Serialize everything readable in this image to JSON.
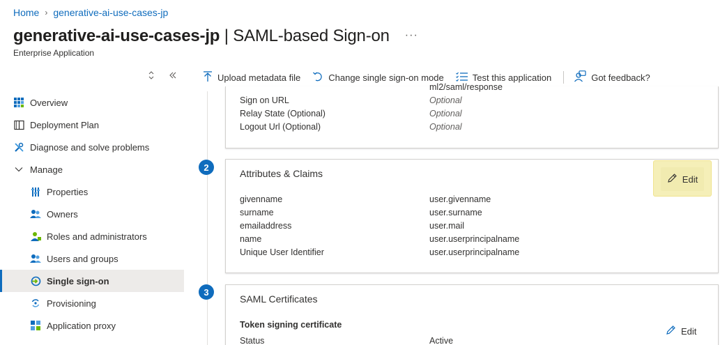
{
  "breadcrumb": {
    "home": "Home",
    "app": "generative-ai-use-cases-jp"
  },
  "header": {
    "title_app": "generative-ai-use-cases-jp",
    "title_sep": " | ",
    "title_page": "SAML-based Sign-on",
    "more": "···",
    "subtitle": "Enterprise Application"
  },
  "sidebar": {
    "items": [
      {
        "label": "Overview"
      },
      {
        "label": "Deployment Plan"
      },
      {
        "label": "Diagnose and solve problems"
      },
      {
        "label": "Manage"
      },
      {
        "label": "Properties"
      },
      {
        "label": "Owners"
      },
      {
        "label": "Roles and administrators"
      },
      {
        "label": "Users and groups"
      },
      {
        "label": "Single sign-on"
      },
      {
        "label": "Provisioning"
      },
      {
        "label": "Application proxy"
      }
    ]
  },
  "toolbar": {
    "upload": "Upload metadata file",
    "change": "Change single sign-on mode",
    "test": "Test this application",
    "feedback": "Got feedback?"
  },
  "basic_config": {
    "clipped_value": "ml2/saml/response",
    "rows": [
      {
        "key": "Sign on URL",
        "value": "Optional"
      },
      {
        "key": "Relay State (Optional)",
        "value": "Optional"
      },
      {
        "key": "Logout Url (Optional)",
        "value": "Optional"
      }
    ]
  },
  "attributes": {
    "step": "2",
    "title": "Attributes & Claims",
    "edit": "Edit",
    "rows": [
      {
        "key": "givenname",
        "value": "user.givenname"
      },
      {
        "key": "surname",
        "value": "user.surname"
      },
      {
        "key": "emailaddress",
        "value": "user.mail"
      },
      {
        "key": "name",
        "value": "user.userprincipalname"
      },
      {
        "key": "Unique User Identifier",
        "value": "user.userprincipalname"
      }
    ]
  },
  "certificates": {
    "step": "3",
    "title": "SAML Certificates",
    "subheading": "Token signing certificate",
    "edit": "Edit",
    "rows": [
      {
        "key": "Status",
        "value": "Active"
      }
    ]
  },
  "colors": {
    "accent": "#0f6cbd",
    "highlight": "#f5efb8"
  }
}
